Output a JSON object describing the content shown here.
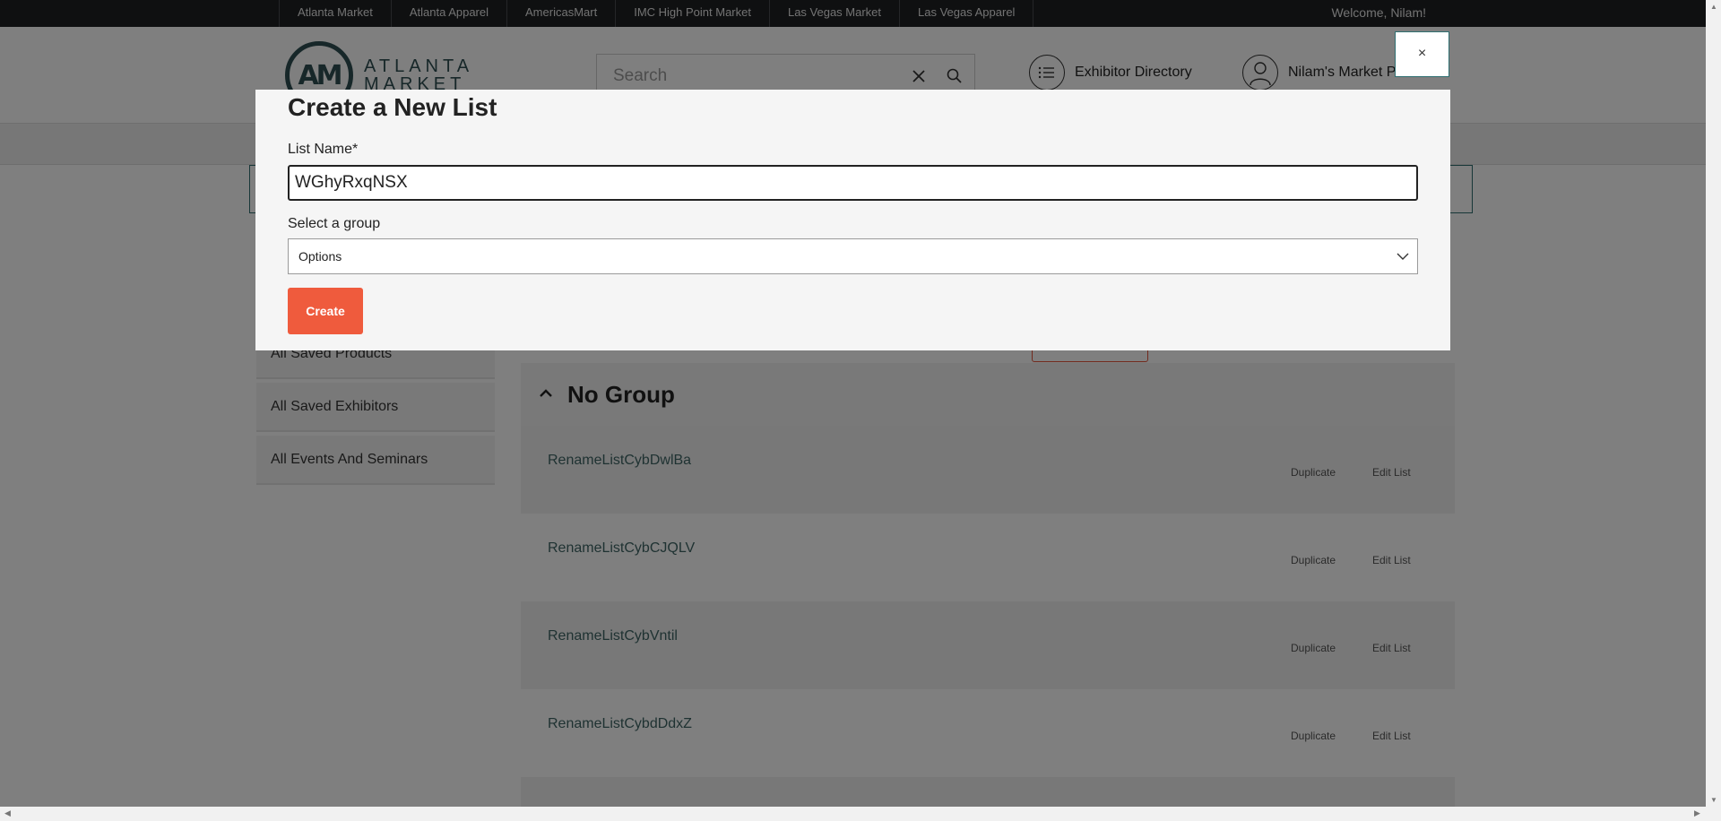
{
  "topbar": {
    "links": [
      "Atlanta Market",
      "Atlanta Apparel",
      "AmericasMart",
      "IMC High Point Market",
      "Las Vegas Market",
      "Las Vegas Apparel"
    ],
    "welcome": "Welcome, Nilam!"
  },
  "header": {
    "logo_mark": "AM",
    "logo_line1": "ATLANTA",
    "logo_line2": "MARKET",
    "search_placeholder": "Search",
    "exhibitor_directory": "Exhibitor Directory",
    "planner": "Nilam's Market Planner"
  },
  "sidebar": {
    "items": [
      "All Saved Products",
      "All Saved Exhibitors",
      "All Events And Seminars"
    ]
  },
  "group": {
    "title": "No Group",
    "rows": [
      {
        "name": "RenameListCybDwlBa",
        "duplicate": "Duplicate",
        "edit": "Edit List"
      },
      {
        "name": "RenameListCybCJQLV",
        "duplicate": "Duplicate",
        "edit": "Edit List"
      },
      {
        "name": "RenameListCybVntil",
        "duplicate": "Duplicate",
        "edit": "Edit List"
      },
      {
        "name": "RenameListCybdDdxZ",
        "duplicate": "Duplicate",
        "edit": "Edit List"
      }
    ]
  },
  "modal": {
    "title": "Create a New List",
    "name_label": "List Name*",
    "name_value": "WGhyRxqNSX",
    "group_label": "Select a group",
    "group_selected": "Options",
    "create_label": "Create",
    "close_label": "×"
  },
  "colors": {
    "accent": "#ef5b3d",
    "brand": "#2f4f52",
    "topbar": "#1f2123"
  }
}
